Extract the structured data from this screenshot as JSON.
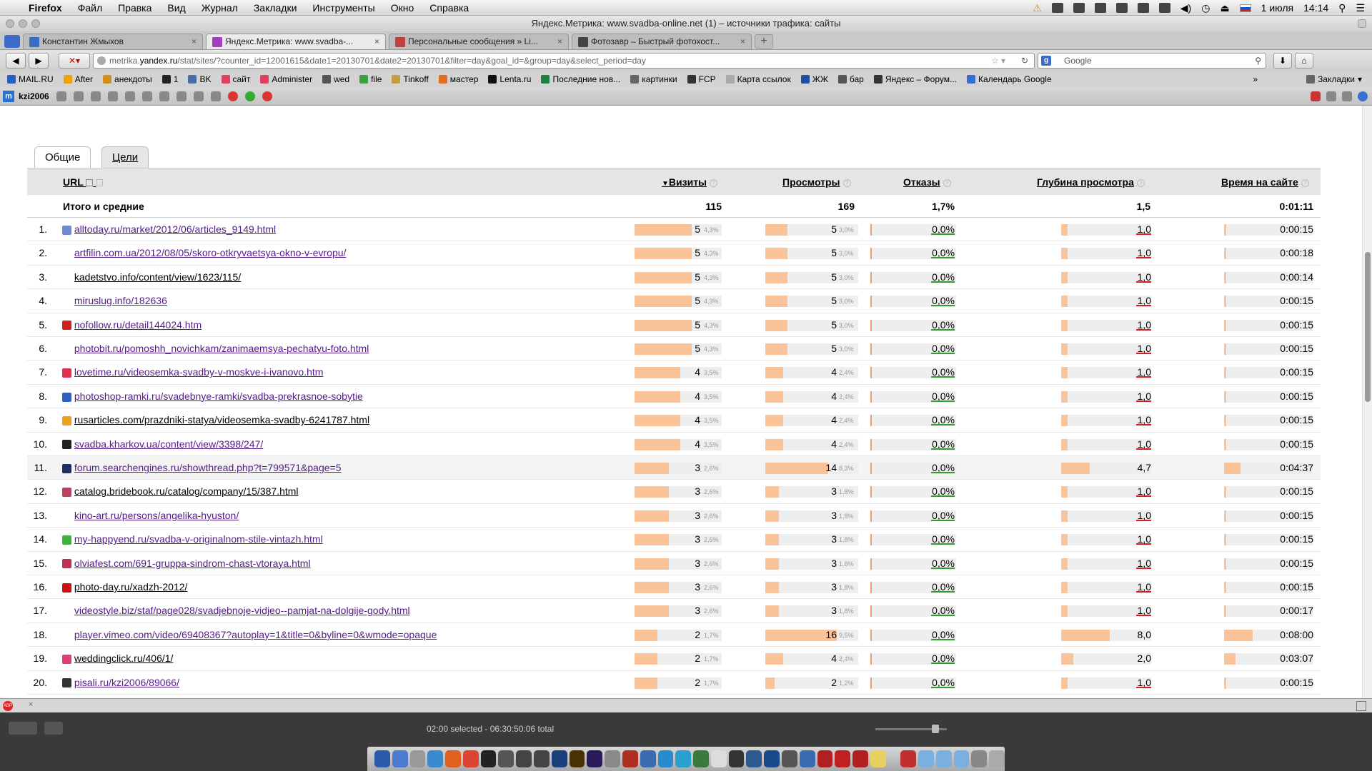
{
  "menubar": {
    "app": "Firefox",
    "items": [
      "Файл",
      "Правка",
      "Вид",
      "Журнал",
      "Закладки",
      "Инструменты",
      "Окно",
      "Справка"
    ],
    "date": "1 июля",
    "time": "14:14"
  },
  "window": {
    "title": "Яндекс.Метрика: www.svadba-online.net (1) – источники трафика: сайты"
  },
  "tabs": [
    {
      "label": "Константин Жмыхов",
      "color": "#3b6cc8"
    },
    {
      "label": "Яндекс.Метрика: www.svadba-...",
      "color": "#a040c0"
    },
    {
      "label": "Персональные сообщения » Li...",
      "color": "#c04040"
    },
    {
      "label": "Фотозавр – Быстрый фотохост...",
      "color": "#444444"
    }
  ],
  "navbar": {
    "url_host": "metrika.",
    "url_domain": "yandex.ru",
    "url_path": "/stat/sites/?counter_id=12001615&date1=20130701&date2=20130701&filter=day&goal_id=&group=day&select_period=day",
    "search_placeholder": "Google"
  },
  "bookmarks": [
    "MAIL.RU",
    "After",
    "анекдоты",
    "1",
    "BK",
    "сайт",
    "Administer",
    "wed",
    "file",
    "Tinkoff",
    "мастер",
    "Lenta.ru",
    "Последние нов...",
    "картинки",
    "FCP",
    "Карта ссылок",
    "ЖЖ",
    "бар",
    "Яндекс – Форум...",
    "Календарь Google"
  ],
  "bookmarks_menu": "Закладки",
  "addon": {
    "user": "kzi2006"
  },
  "page": {
    "tab_general": "Общие",
    "tab_goals": "Цели",
    "headers": {
      "url": "URL",
      "visits": "Визиты",
      "views": "Просмотры",
      "bounces": "Отказы",
      "depth": "Глубина просмотра",
      "time": "Время на сайте"
    },
    "totals": {
      "label": "Итого и средние",
      "visits": "115",
      "views": "169",
      "bounces": "1,7%",
      "depth": "1,5",
      "time": "0:01:11"
    },
    "rows": [
      {
        "n": "1.",
        "url": "alltoday.ru/market/2012/06/articles_9149.html",
        "visited": true,
        "visits": "5",
        "vp": "4,3%",
        "views": "5",
        "wp": "3,0%",
        "bounce": "0,0%",
        "depth": "1,0",
        "time": "0:00:15",
        "v": 5,
        "w": 5,
        "d": 1.0,
        "t": 15,
        "icon": "#6d8ad0"
      },
      {
        "n": "2.",
        "url": "artfilin.com.ua/2012/08/05/skoro-otkryvaetsya-okno-v-evropu/",
        "visited": true,
        "visits": "5",
        "vp": "4,3%",
        "views": "5",
        "wp": "3,0%",
        "bounce": "0,0%",
        "depth": "1,0",
        "time": "0:00:18",
        "v": 5,
        "w": 5,
        "d": 1.0,
        "t": 18,
        "icon": ""
      },
      {
        "n": "3.",
        "url": "kadetstvo.info/content/view/1623/115/",
        "visited": false,
        "visits": "5",
        "vp": "4,3%",
        "views": "5",
        "wp": "3,0%",
        "bounce": "0,0%",
        "depth": "1,0",
        "time": "0:00:14",
        "v": 5,
        "w": 5,
        "d": 1.0,
        "t": 14,
        "icon": ""
      },
      {
        "n": "4.",
        "url": "miruslug.info/182636",
        "visited": true,
        "visits": "5",
        "vp": "4,3%",
        "views": "5",
        "wp": "3,0%",
        "bounce": "0,0%",
        "depth": "1,0",
        "time": "0:00:15",
        "v": 5,
        "w": 5,
        "d": 1.0,
        "t": 15,
        "icon": ""
      },
      {
        "n": "5.",
        "url": "nofollow.ru/detail144024.htm",
        "visited": true,
        "visits": "5",
        "vp": "4,3%",
        "views": "5",
        "wp": "3,0%",
        "bounce": "0,0%",
        "depth": "1,0",
        "time": "0:00:15",
        "v": 5,
        "w": 5,
        "d": 1.0,
        "t": 15,
        "icon": "#d02020"
      },
      {
        "n": "6.",
        "url": "photobit.ru/pomoshh_novichkam/zanimaemsya-pechatyu-foto.html",
        "visited": true,
        "visits": "5",
        "vp": "4,3%",
        "views": "5",
        "wp": "3,0%",
        "bounce": "0,0%",
        "depth": "1,0",
        "time": "0:00:15",
        "v": 5,
        "w": 5,
        "d": 1.0,
        "t": 15,
        "icon": ""
      },
      {
        "n": "7.",
        "url": "lovetime.ru/videosemka-svadby-v-moskve-i-ivanovo.htm",
        "visited": true,
        "visits": "4",
        "vp": "3,5%",
        "views": "4",
        "wp": "2,4%",
        "bounce": "0,0%",
        "depth": "1,0",
        "time": "0:00:15",
        "v": 4,
        "w": 4,
        "d": 1.0,
        "t": 15,
        "icon": "#e03050"
      },
      {
        "n": "8.",
        "url": "photoshop-ramki.ru/svadebnye-ramki/svadba-prekrasnoe-sobytie",
        "visited": true,
        "visits": "4",
        "vp": "3,5%",
        "views": "4",
        "wp": "2,4%",
        "bounce": "0,0%",
        "depth": "1,0",
        "time": "0:00:15",
        "v": 4,
        "w": 4,
        "d": 1.0,
        "t": 15,
        "icon": "#3060c0"
      },
      {
        "n": "9.",
        "url": "rusarticles.com/prazdniki-statya/videosemka-svadby-6241787.html",
        "visited": false,
        "visits": "4",
        "vp": "3,5%",
        "views": "4",
        "wp": "2,4%",
        "bounce": "0,0%",
        "depth": "1,0",
        "time": "0:00:15",
        "v": 4,
        "w": 4,
        "d": 1.0,
        "t": 15,
        "icon": "#f0a020"
      },
      {
        "n": "10.",
        "url": "svadba.kharkov.ua/content/view/3398/247/",
        "visited": true,
        "visits": "4",
        "vp": "3,5%",
        "views": "4",
        "wp": "2,4%",
        "bounce": "0,0%",
        "depth": "1,0",
        "time": "0:00:15",
        "v": 4,
        "w": 4,
        "d": 1.0,
        "t": 15,
        "icon": "#222222"
      },
      {
        "n": "11.",
        "url": "forum.searchengines.ru/showthread.php?t=799571&page=5",
        "visited": true,
        "visits": "3",
        "vp": "2,6%",
        "views": "14",
        "wp": "8,3%",
        "bounce": "0,0%",
        "depth": "4,7",
        "time": "0:04:37",
        "v": 3,
        "w": 14,
        "d": 4.7,
        "t": 277,
        "icon": "#203060",
        "hl": true
      },
      {
        "n": "12.",
        "url": "catalog.bridebook.ru/catalog/company/15/387.html",
        "visited": false,
        "visits": "3",
        "vp": "2,6%",
        "views": "3",
        "wp": "1,8%",
        "bounce": "0,0%",
        "depth": "1,0",
        "time": "0:00:15",
        "v": 3,
        "w": 3,
        "d": 1.0,
        "t": 15,
        "icon": "#c04060"
      },
      {
        "n": "13.",
        "url": "kino-art.ru/persons/angelika-hyuston/",
        "visited": true,
        "visits": "3",
        "vp": "2,6%",
        "views": "3",
        "wp": "1,8%",
        "bounce": "0,0%",
        "depth": "1,0",
        "time": "0:00:15",
        "v": 3,
        "w": 3,
        "d": 1.0,
        "t": 15,
        "icon": ""
      },
      {
        "n": "14.",
        "url": "my-happyend.ru/svadba-v-originalnom-stile-vintazh.html",
        "visited": true,
        "visits": "3",
        "vp": "2,6%",
        "views": "3",
        "wp": "1,8%",
        "bounce": "0,0%",
        "depth": "1,0",
        "time": "0:00:15",
        "v": 3,
        "w": 3,
        "d": 1.0,
        "t": 15,
        "icon": "#40b040"
      },
      {
        "n": "15.",
        "url": "olviafest.com/691-gruppa-sindrom-chast-vtoraya.html",
        "visited": true,
        "visits": "3",
        "vp": "2,6%",
        "views": "3",
        "wp": "1,8%",
        "bounce": "0,0%",
        "depth": "1,0",
        "time": "0:00:15",
        "v": 3,
        "w": 3,
        "d": 1.0,
        "t": 15,
        "icon": "#c03050"
      },
      {
        "n": "16.",
        "url": "photo-day.ru/xadzh-2012/",
        "visited": false,
        "visits": "3",
        "vp": "2,6%",
        "views": "3",
        "wp": "1,8%",
        "bounce": "0,0%",
        "depth": "1,0",
        "time": "0:00:15",
        "v": 3,
        "w": 3,
        "d": 1.0,
        "t": 15,
        "icon": "#d01010"
      },
      {
        "n": "17.",
        "url": "videostyle.biz/staf/page028/svadjebnoje-vidjeo--pamjat-na-dolgije-gody.html",
        "visited": true,
        "visits": "3",
        "vp": "2,6%",
        "views": "3",
        "wp": "1,8%",
        "bounce": "0,0%",
        "depth": "1,0",
        "time": "0:00:17",
        "v": 3,
        "w": 3,
        "d": 1.0,
        "t": 17,
        "icon": ""
      },
      {
        "n": "18.",
        "url": "player.vimeo.com/video/69408367?autoplay=1&title=0&byline=0&wmode=opaque",
        "visited": true,
        "visits": "2",
        "vp": "1,7%",
        "views": "16",
        "wp": "9,5%",
        "bounce": "0,0%",
        "depth": "8,0",
        "time": "0:08:00",
        "v": 2,
        "w": 16,
        "d": 8.0,
        "t": 480,
        "icon": ""
      },
      {
        "n": "19.",
        "url": "weddingclick.ru/406/1/",
        "visited": false,
        "visits": "2",
        "vp": "1,7%",
        "views": "4",
        "wp": "2,4%",
        "bounce": "0,0%",
        "depth": "2,0",
        "time": "0:03:07",
        "v": 2,
        "w": 4,
        "d": 2.0,
        "t": 187,
        "icon": "#e04070"
      },
      {
        "n": "20.",
        "url": "pisali.ru/kzi2006/89066/",
        "visited": true,
        "visits": "2",
        "vp": "1,7%",
        "views": "2",
        "wp": "1,2%",
        "bounce": "0,0%",
        "depth": "1,0",
        "time": "0:00:15",
        "v": 2,
        "w": 2,
        "d": 1.0,
        "t": 15,
        "icon": "#333333"
      }
    ]
  },
  "statusbar": {
    "left": "ABP"
  },
  "sysbar": {
    "selection": "02:00 selected - 06:30:50:06 total"
  },
  "colors": {
    "bar": "#fbc39a",
    "visited": "#551a8b",
    "good": "#2e9e2e",
    "bad": "#d02020"
  }
}
